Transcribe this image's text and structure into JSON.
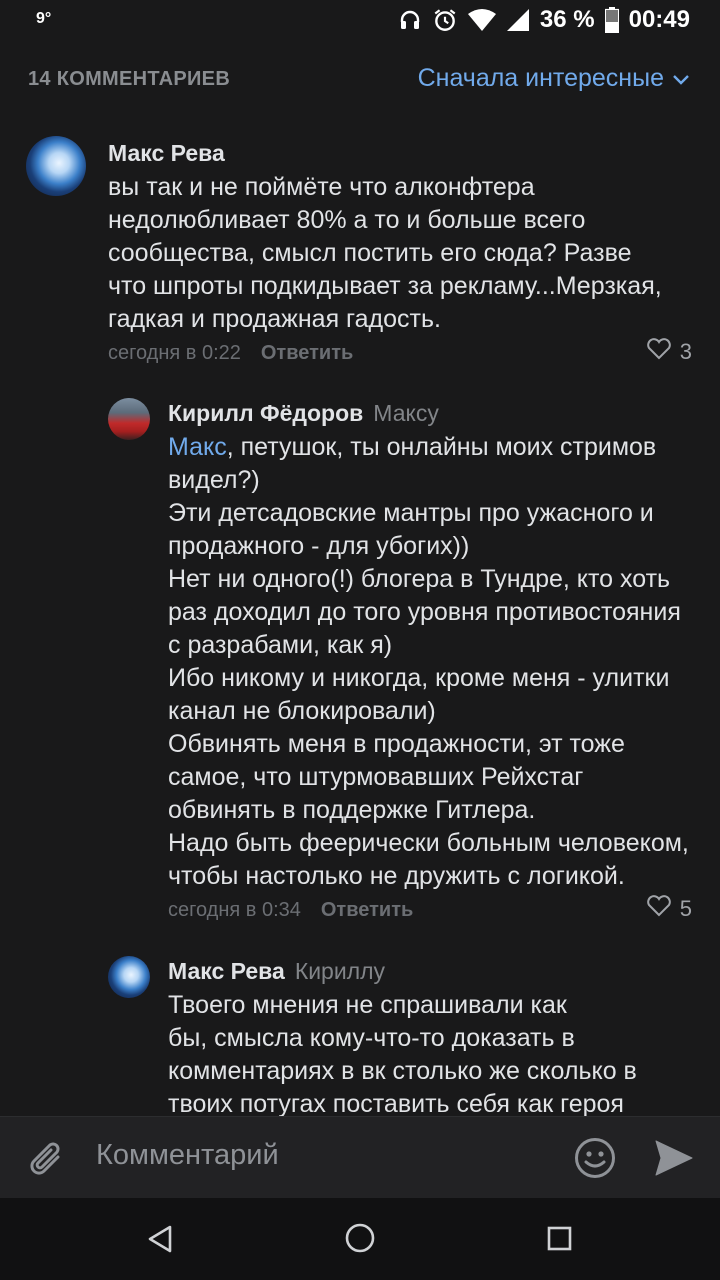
{
  "status": {
    "temperature": "9°",
    "battery_percent": "36 %",
    "time": "00:49"
  },
  "header": {
    "count": "14 КОММЕНТАРИЕВ",
    "sort_label": "Сначала интересные"
  },
  "comments": [
    {
      "author": "Макс Рева",
      "reply_to": "",
      "text": "вы так и не поймёте что алконфтера\nнедолюбливает 80% а то и больше всего\nсообщества, смысл постить его сюда? Разве\nчто шпроты подкидывает за рекламу...Мерзкая,\nгадкая и продажная гадость.",
      "time": "сегодня в 0:22",
      "reply_label": "Ответить",
      "likes": "3"
    },
    {
      "author": "Кирилл Фёдоров",
      "reply_to": "Максу",
      "mention": "Макс",
      "text": ", петушок, ты онлайны моих стримов\nвидел?)\nЭти детсадовские мантры про ужасного и\nпродажного - для убогих))\nНет ни одного(!) блогера в Тундре, кто хоть\nраз доходил до того уровня противостояния\nс разрабами, как я)\nИбо никому и никогда, кроме меня - улитки\nканал не блокировали)\nОбвинять меня в продажности, эт тоже\nсамое, что штурмовавших Рейхстаг\nобвинять в поддержке Гитлера.\nНадо быть феерически больным человеком,\nчтобы настолько не дружить с логикой.",
      "time": "сегодня в 0:34",
      "reply_label": "Ответить",
      "likes": "5"
    },
    {
      "author": "Макс Рева",
      "reply_to": "Кириллу",
      "text": "Твоего мнения не спрашивали как\nбы, смысла кому-что-то доказать в\nкомментариях в вк столько же сколько в\nтвоих потугах поставить себя как героя"
    }
  ],
  "composer": {
    "placeholder": "Комментарий"
  },
  "icons": {
    "attach": "paperclip-icon",
    "emoji": "smile-icon",
    "send": "send-icon"
  }
}
